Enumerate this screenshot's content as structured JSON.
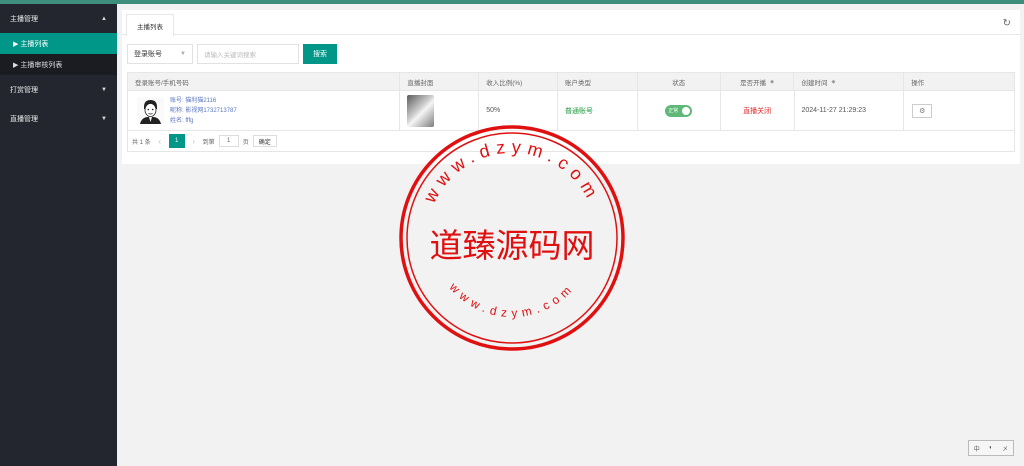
{
  "sidebar": {
    "groups": [
      {
        "label": "主播管理",
        "caret": "▲"
      },
      {
        "label": "打赏管理",
        "caret": "▼"
      },
      {
        "label": "直播管理",
        "caret": "▼"
      }
    ],
    "items": [
      {
        "label": "▶ 主播列表"
      },
      {
        "label": "▶ 主播审核列表"
      }
    ]
  },
  "tabs": [
    {
      "label": "主播列表"
    }
  ],
  "filters": {
    "select_value": "登录账号",
    "search_placeholder": "请输入关键词搜索",
    "search_button": "搜索"
  },
  "table": {
    "headers": [
      "登录账号/手机号码",
      "直播封面",
      "收入比例(%)",
      "账户类型",
      "状态",
      "是否开播",
      "创建时间",
      "操作"
    ],
    "rows": [
      {
        "account": "账号: 猫利猫2116",
        "nickname": "昵称: 影视网1732713787",
        "name": "姓名: fffg",
        "ratio": "50%",
        "type": "普通账号",
        "status": "正常",
        "live": "直播关闭",
        "created": "2024-11-27 21:29:23",
        "op_icon": "gear-icon"
      }
    ]
  },
  "pager": {
    "total": "共 1 条",
    "current": "1",
    "goto_label": "到第",
    "goto_value": "1",
    "page_unit": "页",
    "confirm": "确定"
  },
  "watermark": {
    "center_text": "道臻源码网",
    "ring_text": "www.dzym.com"
  },
  "widget": [
    "中",
    "◐",
    "㐅"
  ]
}
